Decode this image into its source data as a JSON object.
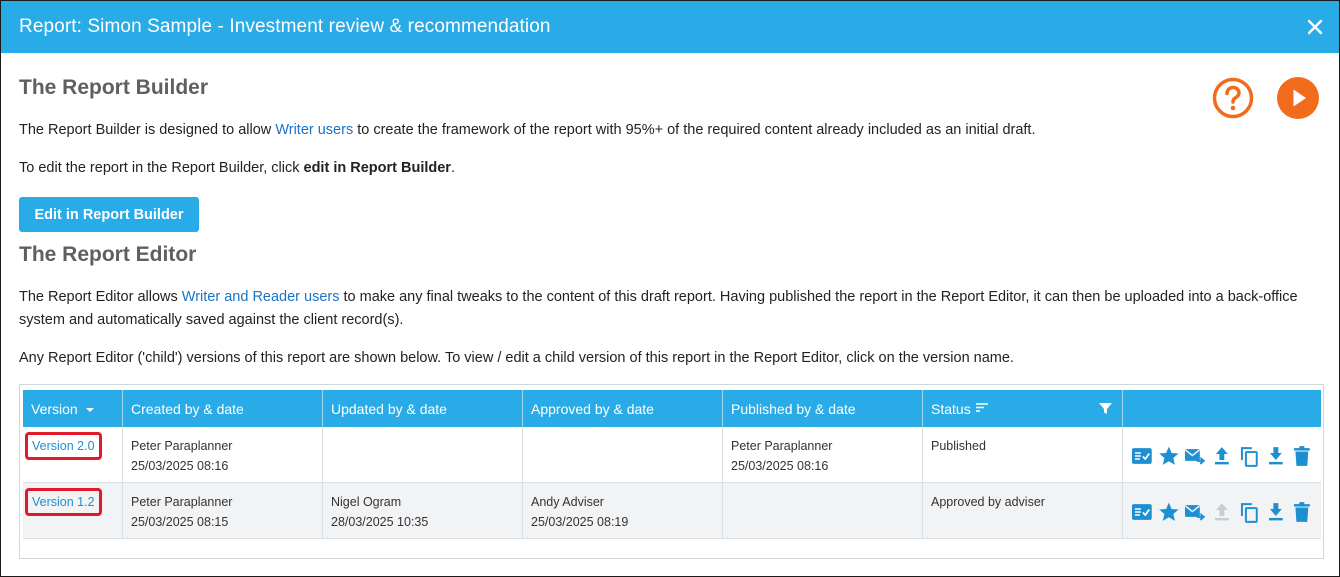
{
  "window": {
    "title": "Report: Simon Sample - Investment review & recommendation",
    "close_icon": "close-icon"
  },
  "builder": {
    "heading": "The Report Builder",
    "para1_pre": "The Report Builder is designed to allow ",
    "para1_link": "Writer users",
    "para1_post": " to create the framework of the report with 95%+ of the required content already included as an initial draft.",
    "para2_pre": "To edit the report in the Report Builder, click ",
    "para2_bold": "edit in Report Builder",
    "para2_post": ".",
    "button_label": "Edit in Report Builder"
  },
  "editor": {
    "heading": "The Report Editor",
    "para1_pre": "The Report Editor allows ",
    "para1_link": "Writer and Reader users",
    "para1_post": " to make any final tweaks to the content of this draft report. Having published the report in the Report Editor, it can then be uploaded into a back-office system and automatically saved against the client record(s).",
    "para2": "Any Report Editor ('child') versions of this report are shown below. To view / edit a child version of this report in the Report Editor, click on the version name."
  },
  "colors": {
    "accent": "#29abe8",
    "orange": "#f26b1d",
    "highlight": "#e0192b",
    "link": "#1a73c8"
  },
  "table": {
    "columns": [
      "Version",
      "Created by & date",
      "Updated by & date",
      "Approved by & date",
      "Published by & date",
      "Status",
      ""
    ],
    "rows": [
      {
        "version": "Version 2.0",
        "created_by": "Peter Paraplanner",
        "created_at": "25/03/2025 08:16",
        "updated_by": "",
        "updated_at": "",
        "approved_by": "",
        "approved_at": "",
        "published_by": "Peter Paraplanner",
        "published_at": "25/03/2025 08:16",
        "status": "Published",
        "upload_enabled": true
      },
      {
        "version": "Version 1.2",
        "created_by": "Peter Paraplanner",
        "created_at": "25/03/2025 08:15",
        "updated_by": "Nigel Ogram",
        "updated_at": "28/03/2025 10:35",
        "approved_by": "Andy Adviser",
        "approved_at": "25/03/2025 08:19",
        "published_by": "",
        "published_at": "",
        "status": "Approved by adviser",
        "upload_enabled": false
      }
    ],
    "action_icons": [
      "checklist-icon",
      "star-icon",
      "email-forward-icon",
      "upload-icon",
      "copy-icon",
      "download-icon",
      "trash-icon"
    ]
  }
}
